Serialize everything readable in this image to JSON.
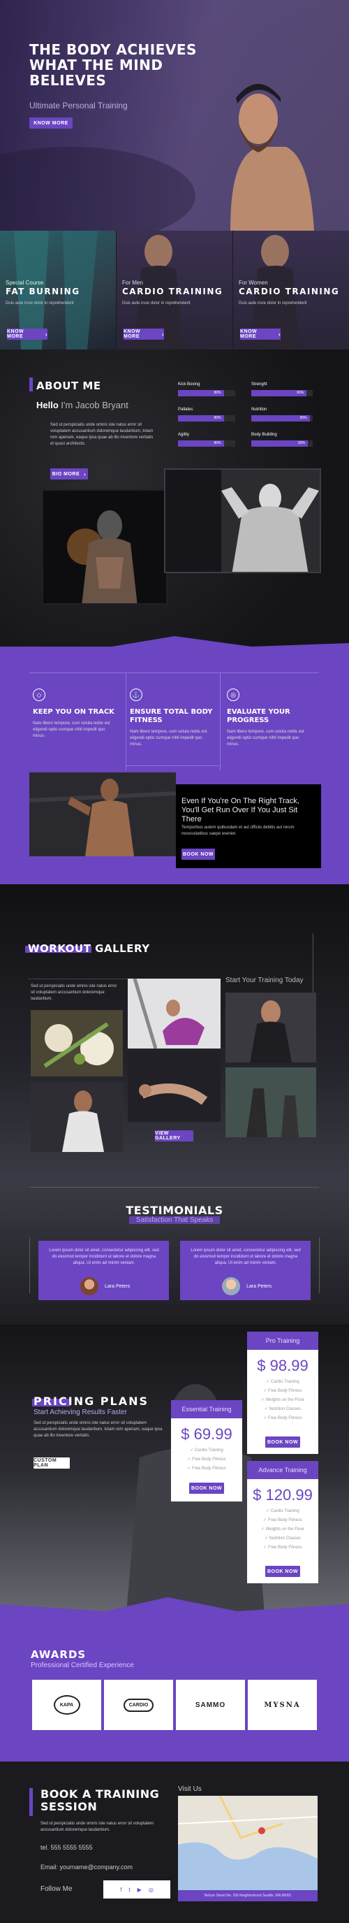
{
  "hero": {
    "title_lines": [
      "THE BODY ACHIEVES",
      "WHAT THE MIND",
      "BELIEVES"
    ],
    "subtitle": "Ultimate Personal Training",
    "button": "KNOW MORE"
  },
  "cards": [
    {
      "kicker": "Special Course",
      "title": "FAT BURNING",
      "text": "Duis aute irure dolor in reprehenderit",
      "button": "KNOW MORE"
    },
    {
      "kicker": "For Men",
      "title": "CARDIO TRAINING",
      "text": "Duis aute irure dolor in reprehenderit",
      "button": "KNOW MORE"
    },
    {
      "kicker": "For Women",
      "title": "CARDIO TRAINING",
      "text": "Duis aute irure dolor in reprehenderit",
      "button": "KNOW MORE"
    }
  ],
  "about": {
    "heading": "ABOUT ME",
    "hello": "Hello",
    "name": "I'm Jacob Bryant",
    "text": "Sed ut perspiciatis unde omnis iste natus error sit voluptatem accusantium doloremque laudantium, totam rem aperiam, eaque ipsa quae ab illo inventore veritatis et quasi architecto.",
    "button": "BIO MORE",
    "skills": [
      {
        "label": "Kick Boxing",
        "value": 80,
        "display": "80%"
      },
      {
        "label": "Strenght",
        "value": 90,
        "display": "90%"
      },
      {
        "label": "Pallates",
        "value": 80,
        "display": "80%"
      },
      {
        "label": "Nutrition",
        "value": 95,
        "display": "95%"
      },
      {
        "label": "Agility",
        "value": 80,
        "display": "80%"
      },
      {
        "label": "Body Building",
        "value": 92,
        "display": "92%"
      }
    ]
  },
  "features": [
    {
      "icon": "diamond-icon",
      "title": "KEEP YOU ON TRACK",
      "text": "Nam libero tempore, cum soluta nobis est eligendi optio cumque nihil impedit quo minus."
    },
    {
      "icon": "anchor-icon",
      "title": "ENSURE TOTAL BODY FITNESS",
      "text": "Nam libero tempore, cum soluta nobis est eligendi optio cumque nihil impedit quo minus."
    },
    {
      "icon": "target-icon",
      "title": "EVALUATE YOUR PROGRESS",
      "text": "Nam libero tempore, cum soluta nobis est eligendi optio cumque nihil impedit quo minus."
    }
  ],
  "cta": {
    "quote": "Even If You're On The Right Track, You'll Get Run Over If You Just Sit There",
    "text": "Temporibus autem quibusdam et aut officiis debitis aut rerum necessitatibus saepe eveniet.",
    "button": "BOOK NOW"
  },
  "gallery": {
    "heading": "WORKOUT GALLERY",
    "text": "Sed ut perspiciatis unde omnis iste natus error sit voluptatem accusantium doloremque laudantium.",
    "start": "Start Your Training Today",
    "button": "VIEW GALLERY"
  },
  "testimonials": {
    "heading": "TESTIMONIALS",
    "subheading": "Satisfaction That Speaks",
    "items": [
      {
        "text": "Lorem ipsum dolor sit amet, consectetur adipiscing elit, sed do eiusmod tempor incididunt ut labore et dolore magna aliqua. Ut enim ad minim veniam.",
        "name": "Lara Peters"
      },
      {
        "text": "Lorem ipsum dolor sit amet, consectetur adipiscing elit, sed do eiusmod tempor incididunt ut labore et dolore magna aliqua. Ut enim ad minim veniam.",
        "name": "Lara Peters"
      }
    ]
  },
  "pricing": {
    "heading": "PRICING PLANS",
    "subheading": "Start Achieving Results Faster",
    "text": "Sed ut perspiciatis unde omnis iste natus error sit voluptatem accusantium doloremque laudantium, totam rem aperiam, eaque ipsa quae ab illo inventore veritatis.",
    "button": "CUSTOM PLAN",
    "plans": [
      {
        "name": "Essential Training",
        "price": "$ 69.99",
        "features": [
          "Cardio Training",
          "Free Body Fitness",
          "Free Body Fitness"
        ],
        "button": "BOOK NOW"
      },
      {
        "name": "Pro Training",
        "price": "$ 98.99",
        "features": [
          "Cardio Training",
          "Free Body Fitness",
          "Weights on the Floor",
          "Nutrition Classes",
          "Free Body Fitness"
        ],
        "button": "BOOK NOW"
      },
      {
        "name": "Advance Training",
        "price": "$ 120.99",
        "features": [
          "Cardio Training",
          "Free Body Fitness",
          "Weights on the Floor",
          "Nutrition Classes",
          "Free Body Fitness"
        ],
        "button": "BOOK NOW"
      }
    ]
  },
  "awards": {
    "heading": "AWARDS",
    "subheading": "Professional Certified Experience",
    "logos": [
      "KAPA",
      "CARDIO",
      "SAMMO",
      "MYSNA"
    ]
  },
  "contact": {
    "heading_lines": [
      "BOOK A TRAINING",
      "SESSION"
    ],
    "text": "Sed ut perspiciatis unde omnis iste natus error sit voluptatem accusantium doloremque laudantium.",
    "tel": "tel. 555 5555 5555",
    "email": "Email: yourname@company.com",
    "follow": "Follow Me",
    "visit": "Visit Us",
    "address": "Nelson Street No. 256 Neighborhood Seattle, WA 98001"
  },
  "colors": {
    "accent": "#6b45c2",
    "dark": "#1b1b1f"
  }
}
